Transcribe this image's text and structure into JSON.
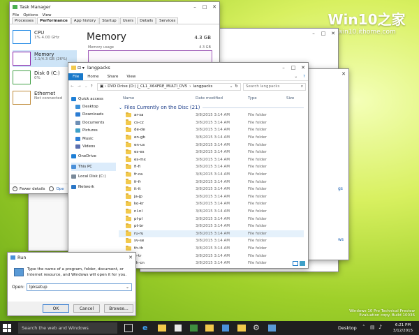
{
  "watermark": {
    "brand": "Win10之家",
    "url": "win10.ithome.com"
  },
  "task_manager": {
    "title": "Task Manager",
    "menu": [
      "File",
      "Options",
      "View"
    ],
    "tabs": [
      "Processes",
      "Performance",
      "App history",
      "Startup",
      "Users",
      "Details",
      "Services"
    ],
    "active_tab": "Performance",
    "sidebar": [
      {
        "name": "CPU",
        "sub": "1% 4.00 GHz",
        "color": "#1e88e5"
      },
      {
        "name": "Memory",
        "sub": "1.1/4.3 GB (26%)",
        "color": "#8e24aa"
      },
      {
        "name": "Disk 0 (C:)",
        "sub": "0%",
        "color": "#43a047"
      },
      {
        "name": "Ethernet",
        "sub": "Not connected",
        "color": "#c08c3c"
      }
    ],
    "main_title": "Memory",
    "main_total": "4.3 GB",
    "usage_label": "Memory usage",
    "usage_total": "4.3 GB",
    "fewer_details": "Fewer details",
    "open_rm": "Ope"
  },
  "explorer": {
    "title": "langpacks",
    "ribbon_tabs": [
      "File",
      "Home",
      "Share",
      "View"
    ],
    "address": [
      "DVD Drive (D:) J_CL1_X64FRE_MULTI_DV5",
      "langpacks"
    ],
    "search_placeholder": "Search langpacks",
    "columns": [
      "Name",
      "Date modified",
      "Type",
      "Size"
    ],
    "group_header": "Files Currently on the Disc (21)",
    "nav": [
      {
        "label": "Quick access",
        "icon": "star-icon",
        "color": "#f5b400"
      },
      {
        "label": "Desktop",
        "icon": "desktop-icon",
        "color": "#3a8fd8"
      },
      {
        "label": "Downloads",
        "icon": "download-icon",
        "color": "#2b7cd3"
      },
      {
        "label": "Documents",
        "icon": "documents-icon",
        "color": "#6e8fb5"
      },
      {
        "label": "Pictures",
        "icon": "pictures-icon",
        "color": "#3fa0c8"
      },
      {
        "label": "Music",
        "icon": "music-icon",
        "color": "#2c7ed6"
      },
      {
        "label": "Videos",
        "icon": "videos-icon",
        "color": "#5a6fb0"
      },
      {
        "label": "OneDrive",
        "icon": "cloud-icon",
        "color": "#1e7fd6"
      },
      {
        "label": "This PC",
        "icon": "computer-icon",
        "color": "#4a90d9"
      },
      {
        "label": "Local Disk (C:)",
        "icon": "drive-icon",
        "color": "#7a8a9a"
      },
      {
        "label": "Network",
        "icon": "network-icon",
        "color": "#2a76c6"
      }
    ],
    "files": [
      {
        "name": "ar-sa",
        "date": "3/8/2015 3:14 AM",
        "type": "File folder"
      },
      {
        "name": "cs-cz",
        "date": "3/8/2015 3:14 AM",
        "type": "File folder"
      },
      {
        "name": "de-de",
        "date": "3/8/2015 3:14 AM",
        "type": "File folder"
      },
      {
        "name": "en-gb",
        "date": "3/8/2015 3:14 AM",
        "type": "File folder"
      },
      {
        "name": "en-us",
        "date": "3/8/2015 3:14 AM",
        "type": "File folder"
      },
      {
        "name": "es-es",
        "date": "3/8/2015 3:14 AM",
        "type": "File folder"
      },
      {
        "name": "es-mx",
        "date": "3/8/2015 3:14 AM",
        "type": "File folder"
      },
      {
        "name": "fi-fi",
        "date": "3/8/2015 3:14 AM",
        "type": "File folder"
      },
      {
        "name": "fr-ca",
        "date": "3/8/2015 3:14 AM",
        "type": "File folder"
      },
      {
        "name": "fr-fr",
        "date": "3/8/2015 3:14 AM",
        "type": "File folder"
      },
      {
        "name": "it-it",
        "date": "3/8/2015 3:14 AM",
        "type": "File folder"
      },
      {
        "name": "ja-jp",
        "date": "3/8/2015 3:14 AM",
        "type": "File folder"
      },
      {
        "name": "ko-kr",
        "date": "3/8/2015 3:14 AM",
        "type": "File folder"
      },
      {
        "name": "nl-nl",
        "date": "3/8/2015 3:14 AM",
        "type": "File folder"
      },
      {
        "name": "pl-pl",
        "date": "3/8/2015 3:14 AM",
        "type": "File folder"
      },
      {
        "name": "pt-br",
        "date": "3/8/2015 3:14 AM",
        "type": "File folder"
      },
      {
        "name": "ru-ru",
        "date": "3/8/2015 3:14 AM",
        "type": "File folder"
      },
      {
        "name": "sv-se",
        "date": "3/8/2015 3:14 AM",
        "type": "File folder"
      },
      {
        "name": "th-th",
        "date": "3/8/2015 3:14 AM",
        "type": "File folder"
      },
      {
        "name": "tr-tr",
        "date": "3/8/2015 3:14 AM",
        "type": "File folder"
      },
      {
        "name": "zh-cn",
        "date": "3/8/2015 3:14 AM",
        "type": "File folder"
      }
    ]
  },
  "bg_window": {
    "partial_text_1": "gs",
    "partial_text_2": "ws"
  },
  "run": {
    "title": "Run",
    "description": "Type the name of a program, folder, document, or Internet resource, and Windows will open it for you.",
    "open_label": "Open:",
    "open_value": "lpksetup",
    "buttons": [
      "OK",
      "Cancel",
      "Browse..."
    ]
  },
  "taskbar": {
    "search_placeholder": "Search the web and Windows",
    "desktop_label": "Desktop",
    "time": "6:21 PM",
    "date": "3/12/2015"
  },
  "os_watermark": {
    "line1": "Windows 10 Pro Technical Preview",
    "line2": "Evaluation copy. Build 10036"
  }
}
